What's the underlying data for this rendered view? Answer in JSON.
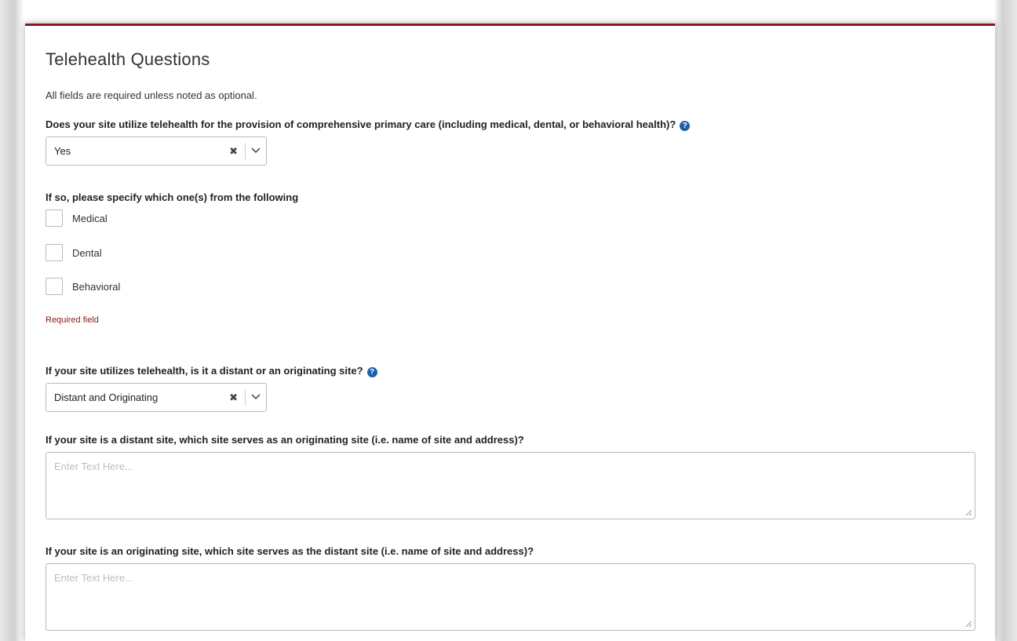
{
  "form": {
    "title": "Telehealth Questions",
    "required_note": "All fields are required unless noted as optional.",
    "q1": {
      "label": "Does your site utilize telehealth for the provision of comprehensive primary care (including medical, dental, or behavioral health)?",
      "selected_value": "Yes",
      "clear_glyph": "✖"
    },
    "q2": {
      "label": "If so, please specify which one(s) from the following",
      "options": [
        {
          "label": "Medical",
          "checked": false
        },
        {
          "label": "Dental",
          "checked": false
        },
        {
          "label": "Behavioral",
          "checked": false
        }
      ],
      "error": "Required field"
    },
    "q3": {
      "label": "If your site utilizes telehealth, is it a distant or an originating site?",
      "selected_value": "Distant and Originating",
      "clear_glyph": "✖"
    },
    "q4": {
      "label": "If your site is a distant site, which site serves as an originating site (i.e. name of site and address)?",
      "value": "",
      "placeholder": "Enter Text Here..."
    },
    "q5": {
      "label": "If your site is an originating site, which site serves as the distant site (i.e. name of site and address)?",
      "value": "",
      "placeholder": "Enter Text Here..."
    },
    "help_glyph": "?"
  },
  "colors": {
    "accent_border": "#8a1a1a",
    "error_text": "#8a1a1a",
    "help_icon": "#1f5fa8"
  }
}
